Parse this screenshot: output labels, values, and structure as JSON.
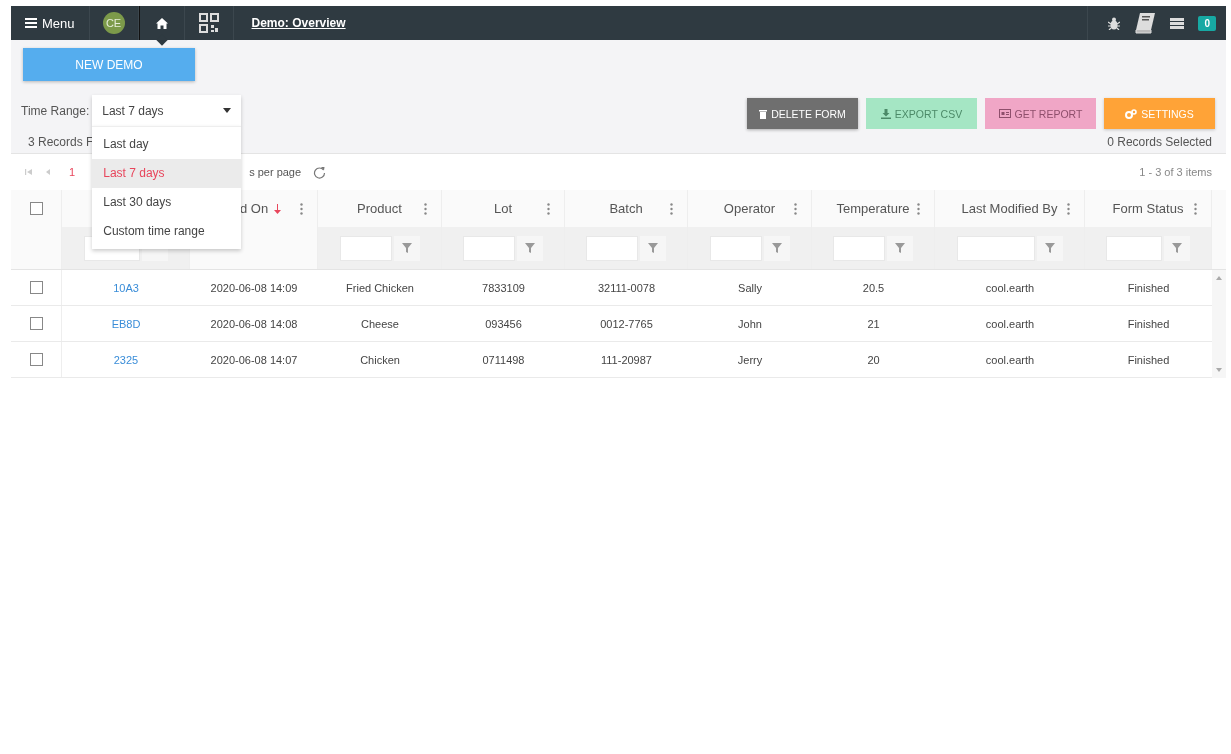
{
  "nav": {
    "menu_label": "Menu",
    "avatar": "CE",
    "home_selected": true,
    "title": "Demo: Overview",
    "badge": "0"
  },
  "new_button": "NEW DEMO",
  "time_range": {
    "label": "Time Range:",
    "value": "Last 7 days",
    "expanded": true,
    "options": [
      {
        "label": "Last day",
        "selected": false
      },
      {
        "label": "Last 7 days",
        "selected": true
      },
      {
        "label": "Last 30 days",
        "selected": false
      },
      {
        "label": "Custom time range",
        "selected": false
      }
    ]
  },
  "actions": [
    {
      "kind": "delete",
      "label": "DELETE FORM",
      "disabled": false
    },
    {
      "kind": "export",
      "label": "EXPORT CSV",
      "disabled": true
    },
    {
      "kind": "report",
      "label": "GET REPORT",
      "disabled": true
    },
    {
      "kind": "settings",
      "label": "SETTINGS",
      "disabled": false
    }
  ],
  "records_found": "3 Records F",
  "records_selected": "0 Records Selected",
  "pager": {
    "page": "1",
    "per_page": "s per page",
    "summary": "1 - 3 of 3 items"
  },
  "table": {
    "all_checked": false,
    "columns": [
      null,
      {
        "label": "d On",
        "sort_descending": true
      },
      {
        "label": "Product",
        "sort_descending": false
      },
      {
        "label": "Lot",
        "sort_descending": false
      },
      {
        "label": "Batch",
        "sort_descending": false
      },
      {
        "label": "Operator",
        "sort_descending": false
      },
      {
        "label": "Temperature",
        "sort_descending": false
      },
      {
        "label": "Last Modified By",
        "sort_descending": false
      },
      {
        "label": "Form Status",
        "sort_descending": false
      }
    ],
    "rows": [
      {
        "checked": false,
        "cells": [
          "10A3",
          "2020-06-08 14:09",
          "Fried Chicken",
          "7833109",
          "32111-0078",
          "Sally",
          "20.5",
          "cool.earth",
          "Finished"
        ]
      },
      {
        "checked": false,
        "cells": [
          "EB8D",
          "2020-06-08 14:08",
          "Cheese",
          "093456",
          "0012-7765",
          "John",
          "21",
          "cool.earth",
          "Finished"
        ]
      },
      {
        "checked": false,
        "cells": [
          "2325",
          "2020-06-08 14:07",
          "Chicken",
          "0711498",
          "111-20987",
          "Jerry",
          "20",
          "cool.earth",
          "Finished"
        ]
      }
    ]
  }
}
